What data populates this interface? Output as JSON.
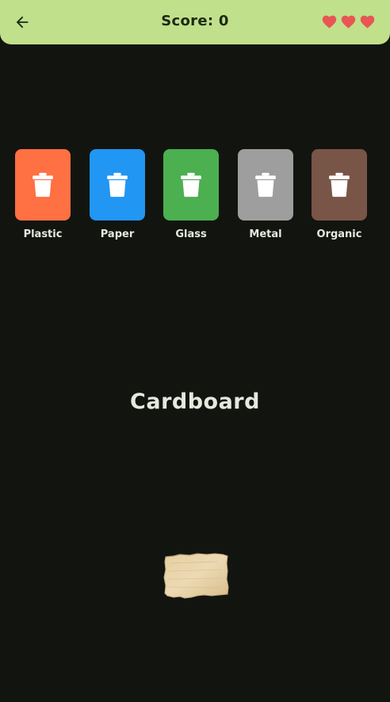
{
  "header": {
    "back_icon": "arrow-left-icon",
    "score_text": "Score: 0",
    "lives": 3,
    "heart_icon": "heart-icon",
    "heart_color": "#e85654",
    "background_color": "#c0e08c"
  },
  "bins": [
    {
      "label": "Plastic",
      "color": "#ff7043",
      "icon": "trash-can-icon"
    },
    {
      "label": "Paper",
      "color": "#2196f3",
      "icon": "trash-can-icon"
    },
    {
      "label": "Glass",
      "color": "#4caf50",
      "icon": "trash-can-icon"
    },
    {
      "label": "Metal",
      "color": "#9e9e9e",
      "icon": "trash-can-icon"
    },
    {
      "label": "Organic",
      "color": "#795548",
      "icon": "trash-can-icon"
    }
  ],
  "current_item": {
    "name": "Cardboard",
    "image": "cardboard-piece"
  },
  "theme": {
    "background": "#121410",
    "text": "#e6e8e0"
  }
}
